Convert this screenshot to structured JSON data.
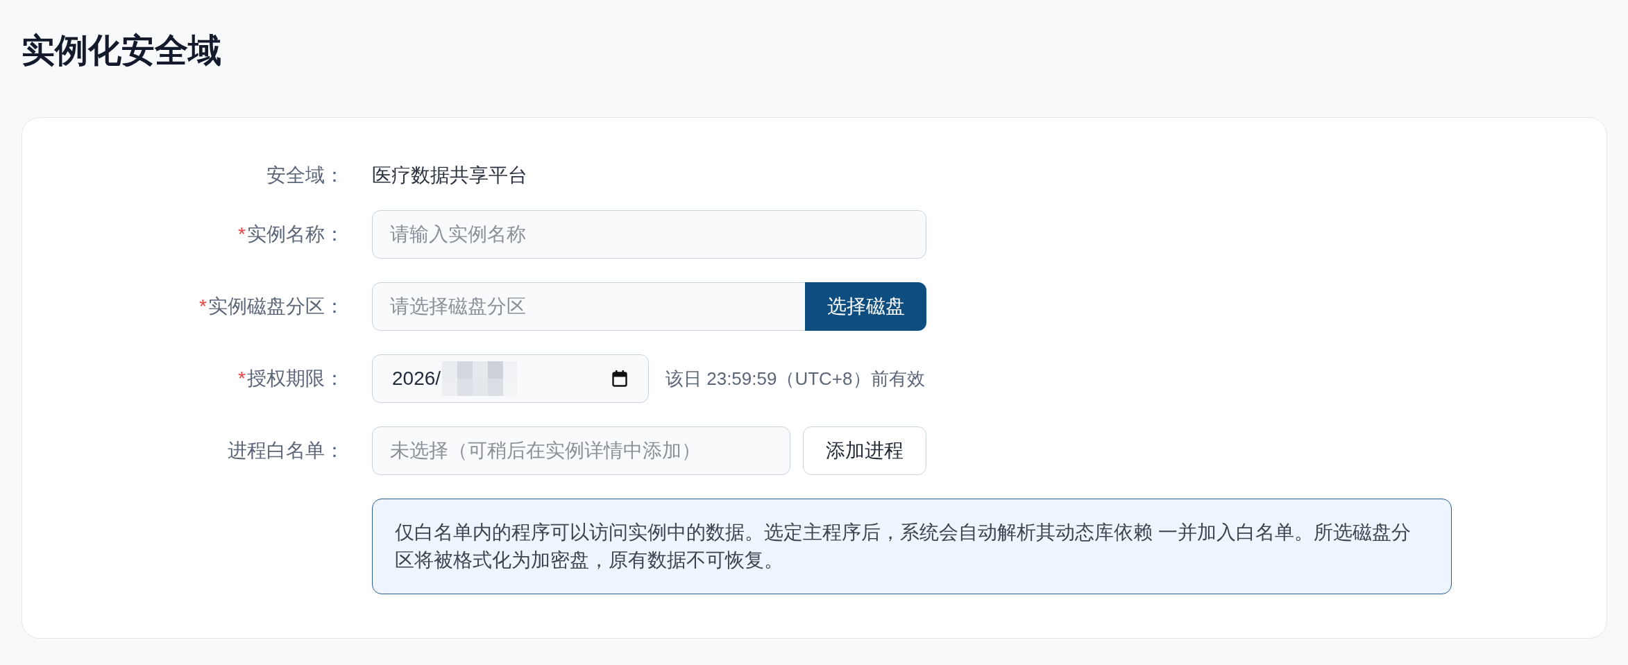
{
  "page": {
    "title": "实例化安全域"
  },
  "form": {
    "fields": [
      {
        "kind": "static",
        "label": "安全域：",
        "value": "医疗数据共享平台"
      },
      {
        "kind": "text_input",
        "required_mark": "*",
        "label": "实例名称：",
        "placeholder": "请输入实例名称"
      },
      {
        "kind": "input_with_button",
        "required_mark": "*",
        "label": "实例磁盘分区：",
        "placeholder": "请选择磁盘分区",
        "button": {
          "label": "选择磁盘",
          "kind": "primary"
        }
      },
      {
        "kind": "date_input",
        "required_mark": "*",
        "label": "授权期限：",
        "value": "2026/",
        "hint": "该日 23:59:59（UTC+8）前有效"
      },
      {
        "kind": "input_with_button",
        "label": "进程白名单：",
        "placeholder": "未选择（可稍后在实例详情中添加）",
        "button": {
          "label": "添加进程",
          "kind": "secondary"
        }
      }
    ],
    "notice": {
      "text": "仅白名单内的程序可以访问实例中的数据。选定主程序后，系统会自动解析其动态库依赖 一并加入白名单。所选磁盘分区将被格式化为加密盘，原有数据不可恢复。"
    }
  }
}
